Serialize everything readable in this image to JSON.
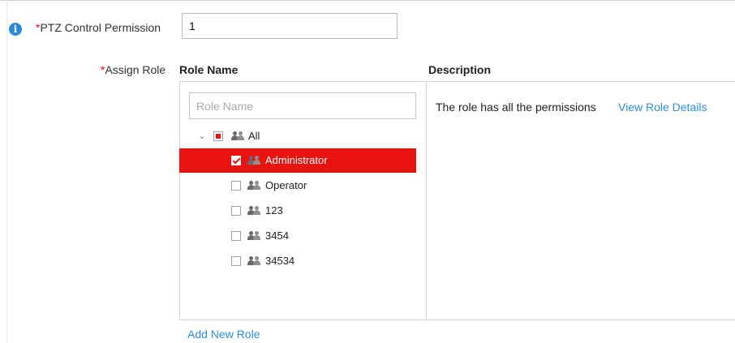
{
  "ptz": {
    "label": "PTZ Control Permission",
    "required_mark": "*",
    "value": "1",
    "info_icon": "info-icon"
  },
  "assign_role": {
    "label": "Assign Role",
    "required_mark": "*",
    "columns": {
      "role_name": "Role Name",
      "description": "Description"
    },
    "search_placeholder": "Role Name",
    "tree": {
      "root": {
        "label": "All",
        "state": "partial",
        "expanded": true
      },
      "roles": [
        {
          "label": "Administrator",
          "checked": true,
          "selected": true
        },
        {
          "label": "Operator",
          "checked": false,
          "selected": false
        },
        {
          "label": "123",
          "checked": false,
          "selected": false
        },
        {
          "label": "3454",
          "checked": false,
          "selected": false
        },
        {
          "label": "34534",
          "checked": false,
          "selected": false
        }
      ]
    },
    "description_text": "The role has all the permissions",
    "view_details_link": "View Role Details",
    "add_new_role": "Add New Role"
  },
  "colors": {
    "accent": "#e8120f",
    "link": "#2b8fe0",
    "info": "#2a88d8"
  }
}
